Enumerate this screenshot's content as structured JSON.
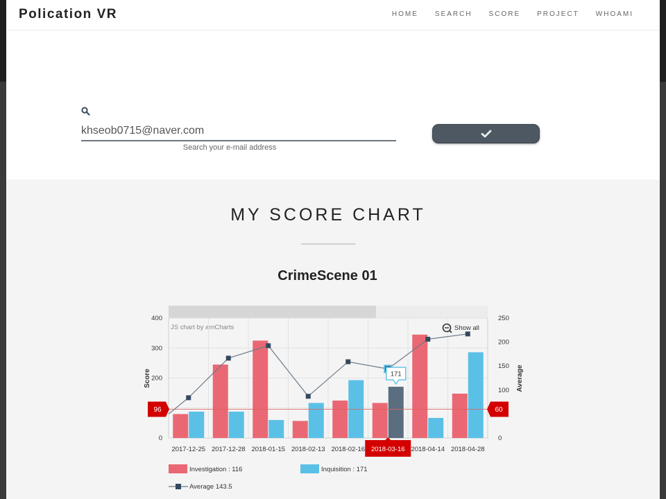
{
  "brand": "Polication VR",
  "nav": {
    "items": [
      "HOME",
      "SEARCH",
      "SCORE",
      "PROJECT",
      "WHOAMI"
    ]
  },
  "search": {
    "icon": "search-icon",
    "value": "khseob0715@naver.com",
    "hint": "Search your e-mail address",
    "submit_icon": "checkmark-icon"
  },
  "section": {
    "title": "MY SCORE CHART"
  },
  "chart": {
    "credit": "JS chart by amCharts",
    "show_all": "Show all",
    "tooltip": "171",
    "left_guide_label": "96",
    "right_guide_label": "60",
    "y_left_title": "Score",
    "y_right_title": "Average",
    "legend": {
      "investigation": "Investigation : 116",
      "inquisition": "Inquisition : 171",
      "average": "Average  143.5"
    }
  },
  "colors": {
    "investigation": "#ea6874",
    "inquisition": "#5bc0e6",
    "average_line": "#6b7a88",
    "average_marker": "#34495e",
    "highlight_bar": "#5b6e80",
    "guide": "#d40000",
    "button": "#4e5863"
  },
  "chart_data": {
    "type": "bar",
    "title": "CrimeScene 01",
    "categories": [
      "2017-12-25",
      "2017-12-28",
      "2018-01-15",
      "2018-02-13",
      "2018-02-16",
      "2018-03-16",
      "2018-04-14",
      "2018-04-28"
    ],
    "selected_category": "2018-03-16",
    "series": [
      {
        "name": "Investigation",
        "axis": "left",
        "values": [
          80,
          245,
          325,
          57,
          125,
          117,
          345,
          148
        ]
      },
      {
        "name": "Inquisition",
        "axis": "left",
        "values": [
          88,
          88,
          60,
          117,
          193,
          171,
          67,
          286
        ]
      },
      {
        "name": "Average",
        "type": "line",
        "axis": "right",
        "values": [
          84,
          166.5,
          192.5,
          87,
          159,
          144,
          206,
          217
        ]
      }
    ],
    "ylabel": "Score",
    "ylim": [
      0,
      400
    ],
    "y2label": "Average",
    "y2lim": [
      0,
      250
    ],
    "yticks": [
      0,
      100,
      200,
      300,
      400
    ],
    "y2ticks": [
      0,
      50,
      100,
      150,
      200,
      250
    ],
    "guide_left": 96,
    "guide_right": 60
  }
}
